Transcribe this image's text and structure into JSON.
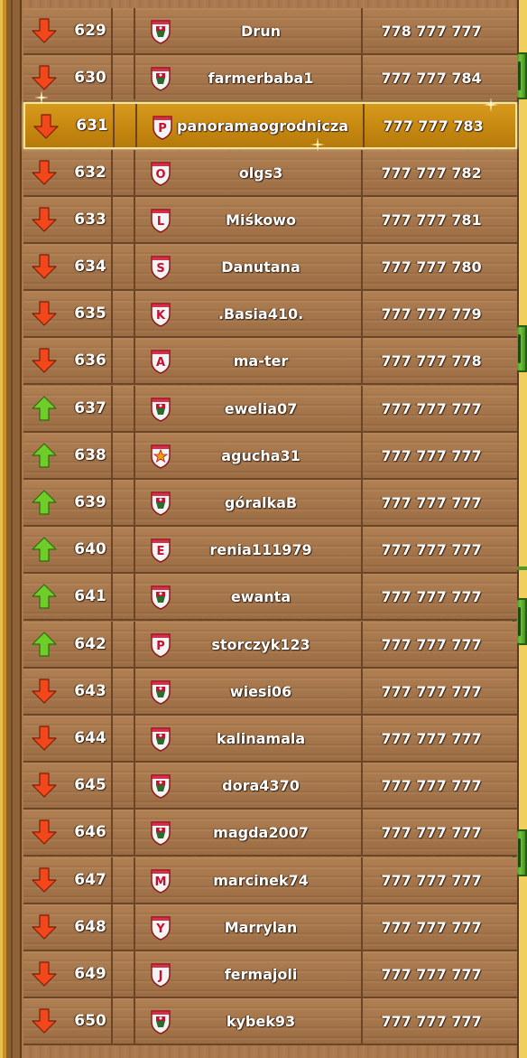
{
  "ranking": {
    "colors": {
      "up": "#6fcd2a",
      "down": "#f2461b",
      "highlight": "#c98a12"
    },
    "rows": [
      {
        "rank": "629",
        "name": "Drun",
        "score": "778 777 777",
        "trend": "down",
        "badge": "emblem"
      },
      {
        "rank": "630",
        "name": "farmerbaba1",
        "score": "777 777 784",
        "trend": "down",
        "badge": "emblem"
      },
      {
        "rank": "631",
        "name": "panoramaogrodnicza",
        "score": "777 777 783",
        "trend": "down",
        "badge": "P",
        "highlighted": true
      },
      {
        "rank": "632",
        "name": "olgs3",
        "score": "777 777 782",
        "trend": "down",
        "badge": "O"
      },
      {
        "rank": "633",
        "name": "Miśkowo",
        "score": "777 777 781",
        "trend": "down",
        "badge": "L"
      },
      {
        "rank": "634",
        "name": "Danutana",
        "score": "777 777 780",
        "trend": "down",
        "badge": "S"
      },
      {
        "rank": "635",
        "name": ".Basia410.",
        "score": "777 777 779",
        "trend": "down",
        "badge": "K"
      },
      {
        "rank": "636",
        "name": "ma-ter",
        "score": "777 777 778",
        "trend": "down",
        "badge": "A"
      },
      {
        "rank": "637",
        "name": "ewelia07",
        "score": "777 777 777",
        "trend": "up",
        "badge": "emblem"
      },
      {
        "rank": "638",
        "name": "agucha31",
        "score": "777 777 777",
        "trend": "up",
        "badge": "star"
      },
      {
        "rank": "639",
        "name": "góralkaB",
        "score": "777 777 777",
        "trend": "up",
        "badge": "emblem"
      },
      {
        "rank": "640",
        "name": "renia111979",
        "score": "777 777 777",
        "trend": "up",
        "badge": "E"
      },
      {
        "rank": "641",
        "name": "ewanta",
        "score": "777 777 777",
        "trend": "up",
        "badge": "emblem"
      },
      {
        "rank": "642",
        "name": "storczyk123",
        "score": "777 777 777",
        "trend": "up",
        "badge": "P"
      },
      {
        "rank": "643",
        "name": "wiesi06",
        "score": "777 777 777",
        "trend": "down",
        "badge": "emblem"
      },
      {
        "rank": "644",
        "name": "kalinamala",
        "score": "777 777 777",
        "trend": "down",
        "badge": "emblem"
      },
      {
        "rank": "645",
        "name": "dora4370",
        "score": "777 777 777",
        "trend": "down",
        "badge": "emblem"
      },
      {
        "rank": "646",
        "name": "magda2007",
        "score": "777 777 777",
        "trend": "down",
        "badge": "emblem"
      },
      {
        "rank": "647",
        "name": "marcinek74",
        "score": "777 777 777",
        "trend": "down",
        "badge": "M"
      },
      {
        "rank": "648",
        "name": "Marrylan",
        "score": "777 777 777",
        "trend": "down",
        "badge": "Y"
      },
      {
        "rank": "649",
        "name": "fermajoli",
        "score": "777 777 777",
        "trend": "down",
        "badge": "J"
      },
      {
        "rank": "650",
        "name": "kybek93",
        "score": "777 777 777",
        "trend": "down",
        "badge": "emblem"
      }
    ]
  }
}
